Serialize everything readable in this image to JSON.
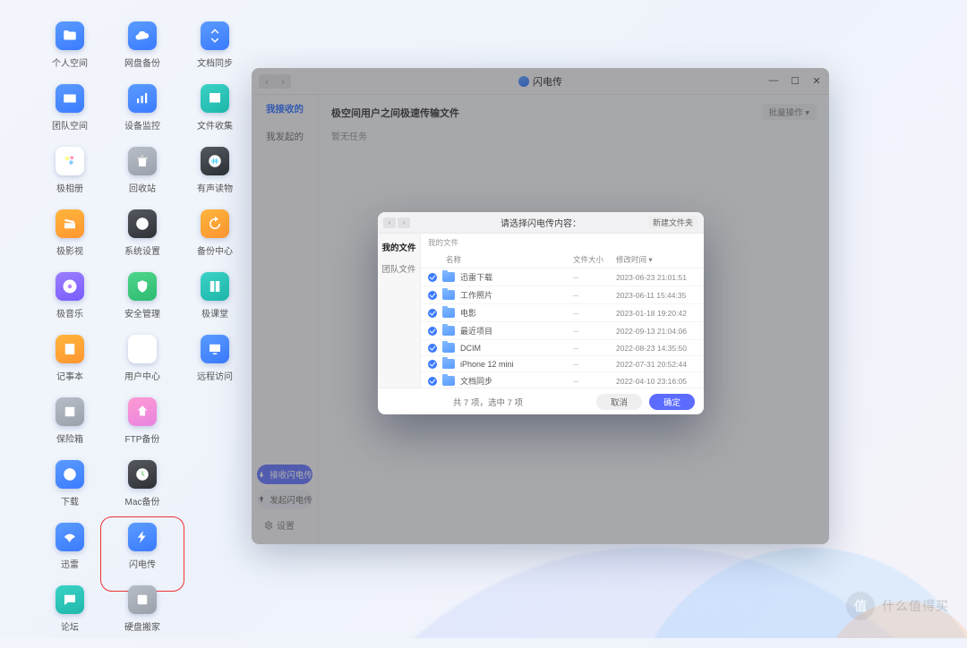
{
  "desktop": {
    "apps": [
      {
        "label": "个人空间",
        "icon": "folder",
        "color": "c-blue"
      },
      {
        "label": "网盘备份",
        "icon": "cloud",
        "color": "c-blue"
      },
      {
        "label": "文档同步",
        "icon": "sync",
        "color": "c-blue"
      },
      {
        "label": "团队空间",
        "icon": "team",
        "color": "c-blue"
      },
      {
        "label": "设备监控",
        "icon": "chart",
        "color": "c-blue"
      },
      {
        "label": "文件收集",
        "icon": "inbox",
        "color": "c-teal"
      },
      {
        "label": "极相册",
        "icon": "photo",
        "color": "c-white"
      },
      {
        "label": "回收站",
        "icon": "trash",
        "color": "c-grey"
      },
      {
        "label": "有声读物",
        "icon": "audio",
        "color": "c-dark"
      },
      {
        "label": "极影视",
        "icon": "movie",
        "color": "c-orange"
      },
      {
        "label": "系统设置",
        "icon": "gear",
        "color": "c-dark"
      },
      {
        "label": "备份中心",
        "icon": "refresh",
        "color": "c-orange"
      },
      {
        "label": "极音乐",
        "icon": "music",
        "color": "c-purple"
      },
      {
        "label": "安全管理",
        "icon": "shield",
        "color": "c-green"
      },
      {
        "label": "极课堂",
        "icon": "book",
        "color": "c-teal"
      },
      {
        "label": "记事本",
        "icon": "note",
        "color": "c-orange"
      },
      {
        "label": "用户中心",
        "icon": "user",
        "color": "c-white"
      },
      {
        "label": "远程访问",
        "icon": "remote",
        "color": "c-blue"
      },
      {
        "label": "保险箱",
        "icon": "safe",
        "color": "c-grey"
      },
      {
        "label": "FTP备份",
        "icon": "ftp",
        "color": "c-pink"
      },
      {
        "label": "",
        "icon": "",
        "color": ""
      },
      {
        "label": "下载",
        "icon": "globe",
        "color": "c-blue"
      },
      {
        "label": "Mac备份",
        "icon": "time",
        "color": "c-dark"
      },
      {
        "label": "",
        "icon": "",
        "color": ""
      },
      {
        "label": "迅雷",
        "icon": "bird",
        "color": "c-blue"
      },
      {
        "label": "闪电传",
        "icon": "bolt",
        "color": "c-blue",
        "hl": true
      },
      {
        "label": "",
        "icon": "",
        "color": ""
      },
      {
        "label": "论坛",
        "icon": "chat",
        "color": "c-teal"
      },
      {
        "label": "硬盘搬家",
        "icon": "disk",
        "color": "c-grey"
      }
    ]
  },
  "window": {
    "title": "闪电传",
    "side": {
      "tabs": [
        "我接收的",
        "我发起的"
      ],
      "active": 0,
      "receive": "接收闪电传",
      "send": "发起闪电传",
      "settings": "设置"
    },
    "main": {
      "heading": "极空间用户之间极速传输文件",
      "empty": "暂无任务",
      "bulk": "批量操作"
    }
  },
  "dialog": {
    "title": "请选择闪电传内容：",
    "new_folder": "新建文件夹",
    "side": {
      "tabs": [
        "我的文件",
        "团队文件"
      ],
      "active": 0
    },
    "crumb": "我的文件",
    "cols": {
      "name": "名称",
      "size": "文件大小",
      "mtime": "修改时间"
    },
    "rows": [
      {
        "name": "迅雷下载",
        "size": "--",
        "mtime": "2023-06-23 21:01:51"
      },
      {
        "name": "工作照片",
        "size": "--",
        "mtime": "2023-06-11 15:44:35"
      },
      {
        "name": "电影",
        "size": "--",
        "mtime": "2023-01-18 19:20:42"
      },
      {
        "name": "最近项目",
        "size": "--",
        "mtime": "2022-09-13 21:04:06"
      },
      {
        "name": "DCIM",
        "size": "--",
        "mtime": "2022-08-23 14:35:50"
      },
      {
        "name": "iPhone 12 mini",
        "size": "--",
        "mtime": "2022-07-31 20:52:44"
      },
      {
        "name": "文档同步",
        "size": "--",
        "mtime": "2022-04-10 23:16:05"
      }
    ],
    "footer": {
      "count": "共 7 项，选中 7 项",
      "cancel": "取消",
      "ok": "确定"
    }
  },
  "watermark": "什么值得买"
}
